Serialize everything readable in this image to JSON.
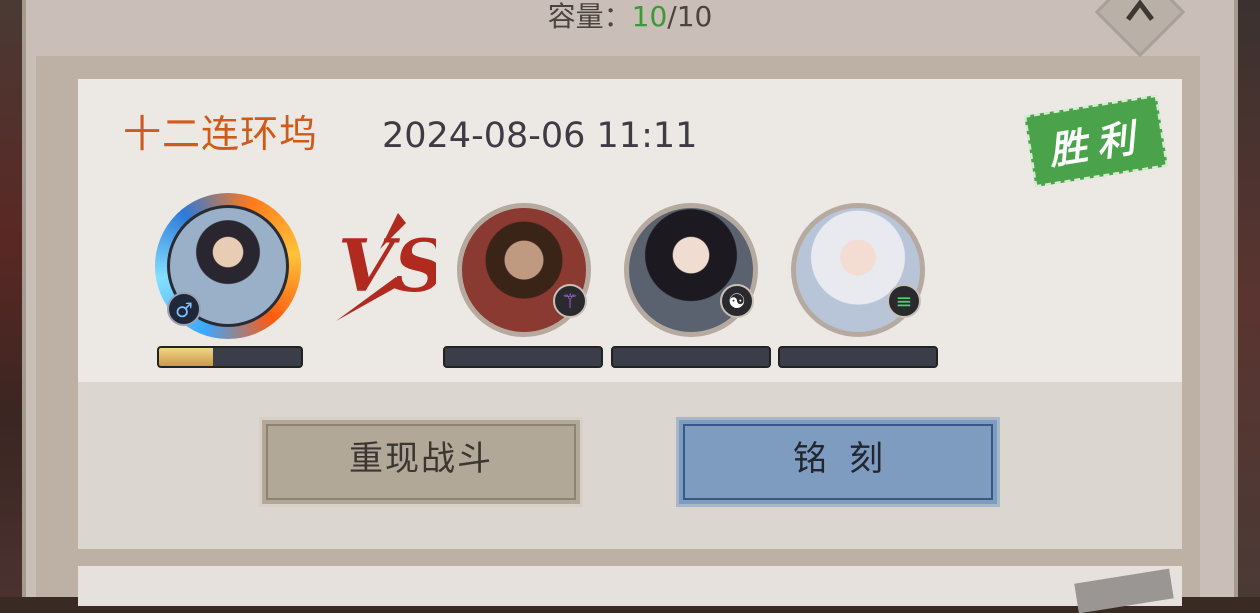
{
  "header": {
    "capacity_label": "容量：",
    "capacity_current": "10",
    "capacity_sep_max": "/10"
  },
  "record": {
    "map_name": "十二连环坞",
    "time": "2024-08-06 11:11",
    "result": "胜利",
    "result_color": "#4aa24a",
    "vs_label": "VS",
    "player": {
      "gender_icon": "♂",
      "hp_fraction": 0.38
    },
    "enemies": [
      {
        "badge_icon": "spear-icon",
        "badge_glyph": "⚚",
        "hp_fraction": 0
      },
      {
        "badge_icon": "yin-yang-icon",
        "badge_glyph": "☯",
        "hp_fraction": 0
      },
      {
        "badge_icon": "boot-icon",
        "badge_glyph": "≡",
        "hp_fraction": 0
      }
    ],
    "buttons": {
      "replay_label": "重现战斗",
      "engrave_label": "铭刻"
    }
  }
}
